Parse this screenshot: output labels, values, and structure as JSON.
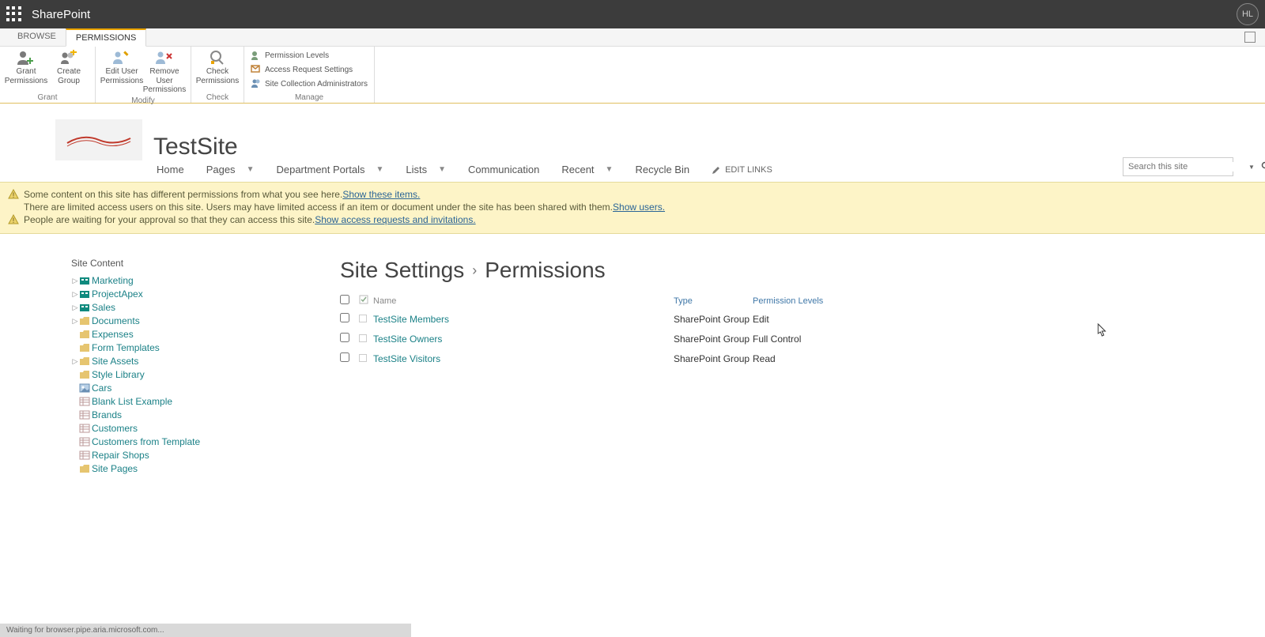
{
  "suite": {
    "title": "SharePoint",
    "avatar": "HL"
  },
  "tabs": {
    "browse": "BROWSE",
    "permissions": "PERMISSIONS"
  },
  "ribbon": {
    "grant_perms": "Grant Permissions",
    "create_group": "Create Group",
    "grant_label": "Grant",
    "edit_user": "Edit User Permissions",
    "remove_user": "Remove User Permissions",
    "modify_label": "Modify",
    "check_perms": "Check Permissions",
    "check_label": "Check",
    "permission_levels": "Permission Levels",
    "access_request": "Access Request Settings",
    "site_collection_admins": "Site Collection Administrators",
    "manage_label": "Manage"
  },
  "site": {
    "title": "TestSite"
  },
  "nav": {
    "home": "Home",
    "pages": "Pages",
    "dept": "Department Portals",
    "lists": "Lists",
    "comm": "Communication",
    "recent": "Recent",
    "recycle": "Recycle Bin",
    "edit_links": "EDIT LINKS"
  },
  "search": {
    "placeholder": "Search this site"
  },
  "notices": {
    "line1a": "Some content on this site has different permissions from what you see here.  ",
    "line1_link": "Show these items.",
    "line2a": "There are limited access users on this site. Users may have limited access if an item or document under the site has been shared with them. ",
    "line2_link": "Show users.",
    "line3a": "People are waiting for your approval so that they can access this site. ",
    "line3_link": "Show access requests and invitations."
  },
  "left_nav": {
    "header": "Site Content",
    "items": [
      {
        "label": "Marketing",
        "type": "site",
        "expand": true
      },
      {
        "label": "ProjectApex",
        "type": "site",
        "expand": true
      },
      {
        "label": "Sales",
        "type": "site",
        "expand": true
      },
      {
        "label": "Documents",
        "type": "lib",
        "expand": true
      },
      {
        "label": "Expenses",
        "type": "lib",
        "expand": false
      },
      {
        "label": "Form Templates",
        "type": "lib",
        "expand": false
      },
      {
        "label": "Site Assets",
        "type": "lib",
        "expand": true
      },
      {
        "label": "Style Library",
        "type": "lib",
        "expand": false
      },
      {
        "label": "Cars",
        "type": "piclib",
        "expand": false
      },
      {
        "label": "Blank List Example",
        "type": "list",
        "expand": false
      },
      {
        "label": "Brands",
        "type": "list",
        "expand": false
      },
      {
        "label": "Customers",
        "type": "list",
        "expand": false
      },
      {
        "label": "Customers from Template",
        "type": "list",
        "expand": false
      },
      {
        "label": "Repair Shops",
        "type": "list",
        "expand": false
      },
      {
        "label": "Site Pages",
        "type": "lib",
        "expand": false
      }
    ]
  },
  "breadcrumb": {
    "part1": "Site Settings",
    "part2": "Permissions"
  },
  "perm_table": {
    "headers": {
      "name": "Name",
      "type": "Type",
      "plevel": "Permission Levels"
    },
    "rows": [
      {
        "name": "TestSite Members",
        "type": "SharePoint Group",
        "plevel": "Edit"
      },
      {
        "name": "TestSite Owners",
        "type": "SharePoint Group",
        "plevel": "Full Control"
      },
      {
        "name": "TestSite Visitors",
        "type": "SharePoint Group",
        "plevel": "Read"
      }
    ]
  },
  "status": "Waiting for browser.pipe.aria.microsoft.com..."
}
